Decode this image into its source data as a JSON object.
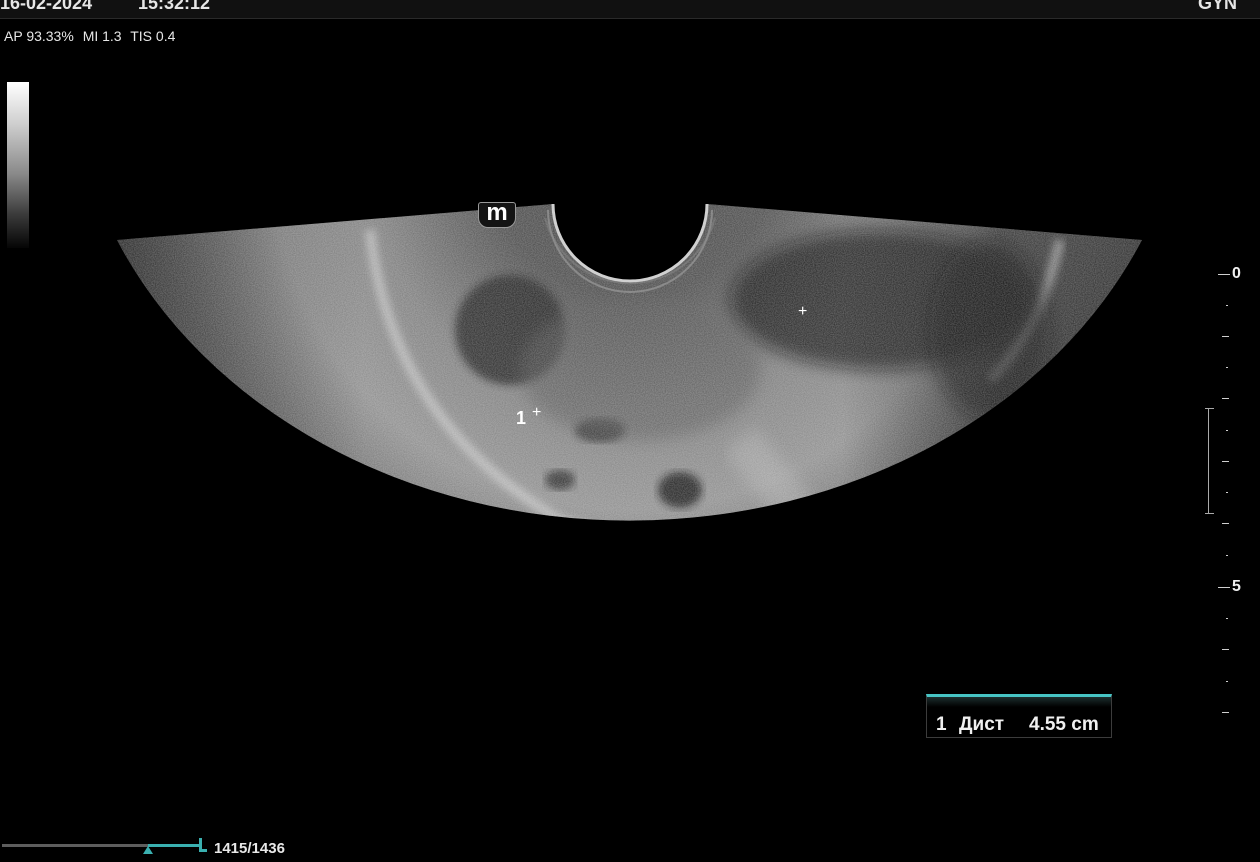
{
  "header": {
    "date": "16-02-2024",
    "time": "15:32:12",
    "preset": "GYN"
  },
  "status": {
    "ap": "AP 93.33%",
    "mi": "MI 1.3",
    "tis": "TIS 0.4"
  },
  "mode_icon": "m",
  "measurement": {
    "index": "1",
    "label": "Дист",
    "value": "4.55 cm"
  },
  "caliper": {
    "start_symbol": "+",
    "end_symbol": "+",
    "marker_number": "1"
  },
  "depth_scale": {
    "labels": [
      "0",
      "5"
    ],
    "icon": "focus-bracket-icon"
  },
  "cine": {
    "counter": "1415/1436",
    "position_fraction": 0.985
  },
  "colors": {
    "accent": "#47c4c4",
    "background": "#000000",
    "text": "#e8e8e8"
  }
}
